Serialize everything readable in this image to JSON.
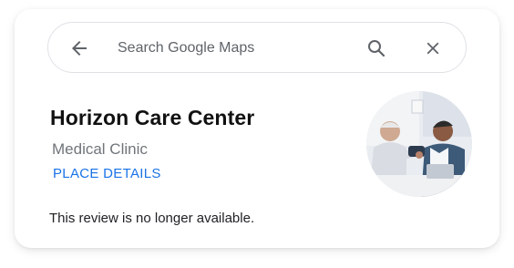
{
  "search": {
    "placeholder": "Search Google Maps",
    "value": ""
  },
  "place": {
    "name": "Horizon Care Center",
    "category": "Medical Clinic",
    "details_link": "PLACE DETAILS",
    "review_notice": "This review is no longer available."
  },
  "icons": {
    "back": "arrow-left",
    "search": "magnifier",
    "close": "x"
  },
  "colors": {
    "link": "#1a73e8",
    "secondary_text": "#70757a",
    "primary_text": "#202124",
    "icon": "#5f6368"
  }
}
